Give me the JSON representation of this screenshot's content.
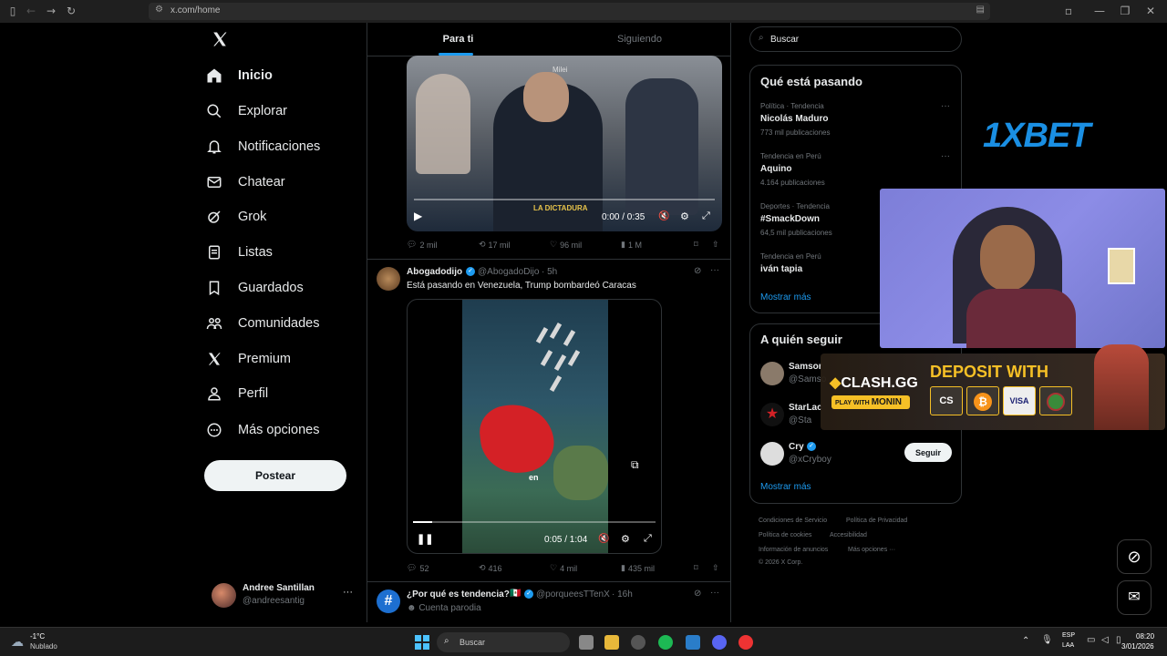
{
  "browser": {
    "url": "x.com/home"
  },
  "nav": {
    "items": [
      {
        "label": "Inicio",
        "icon": "home-icon"
      },
      {
        "label": "Explorar",
        "icon": "search-icon"
      },
      {
        "label": "Notificaciones",
        "icon": "bell-icon"
      },
      {
        "label": "Chatear",
        "icon": "mail-icon"
      },
      {
        "label": "Grok",
        "icon": "grok-icon"
      },
      {
        "label": "Listas",
        "icon": "list-icon"
      },
      {
        "label": "Guardados",
        "icon": "bookmark-icon"
      },
      {
        "label": "Comunidades",
        "icon": "people-icon"
      },
      {
        "label": "Premium",
        "icon": "x-logo-icon"
      },
      {
        "label": "Perfil",
        "icon": "person-icon"
      },
      {
        "label": "Más opciones",
        "icon": "more-circle-icon"
      }
    ],
    "post_label": "Postear"
  },
  "account": {
    "name": "Andree Santillan",
    "handle": "@andreesantig"
  },
  "tabs": {
    "for_you": "Para ti",
    "following": "Siguiendo"
  },
  "tweet1": {
    "video_caption": "LA DICTADURA",
    "video_name_tag": "Milei",
    "time": "0:00 / 0:35",
    "replies": "2 mil",
    "retweets": "17 mil",
    "likes": "96 mil",
    "views": "1 M"
  },
  "tweet2": {
    "name": "Abogadodijo",
    "handle": "@AbogadoDijo",
    "age": "· 5h",
    "text": "Está pasando en Venezuela, Trump bombardeó Caracas",
    "map_label": "en",
    "time": "0:05 / 1:04",
    "progress": 0.08,
    "replies": "52",
    "retweets": "416",
    "likes": "4 mil",
    "views": "435 mil"
  },
  "tweet3": {
    "name": "¿Por qué es tendencia?",
    "flag": "🇲🇽",
    "handle": "@porqueesTTenX",
    "age": "· 16h",
    "badge": "Cuenta parodia"
  },
  "search": {
    "placeholder": "Buscar"
  },
  "trends": {
    "title": "Qué está pasando",
    "items": [
      {
        "meta": "Política · Tendencia",
        "name": "Nicolás Maduro",
        "count": "773 mil publicaciones"
      },
      {
        "meta": "Tendencia en Perú",
        "name": "Aquino",
        "count": "4.164 publicaciones"
      },
      {
        "meta": "Deportes · Tendencia",
        "name": "#SmackDown",
        "count": "64,5 mil publicaciones"
      },
      {
        "meta": "Tendencia en Perú",
        "name": "iván tapia",
        "count": ""
      }
    ],
    "show_more": "Mostrar más"
  },
  "follow": {
    "title": "A quién seguir",
    "items": [
      {
        "name": "Samsor",
        "handle": "@Samso"
      },
      {
        "name": "StarLac",
        "handle": "@Sta"
      },
      {
        "name": "Cry",
        "handle": "@xCryboy"
      }
    ],
    "follow_label": "Seguir",
    "show_more": "Mostrar más"
  },
  "footer": {
    "links": [
      "Condiciones de Servicio",
      "Política de Privacidad",
      "Política de cookies",
      "Accesibilidad",
      "Información de anuncios",
      "Más opciones ···"
    ],
    "copyright": "© 2026 X Corp."
  },
  "overlay": {
    "brand": "1XBET",
    "clash_brand": "CLASH.GG",
    "clash_play": "PLAY WITH",
    "clash_code": "MONIN",
    "deposit": "DEPOSIT WITH",
    "visa": "VISA"
  },
  "taskbar": {
    "temp": "-1°C",
    "weather": "Nublado",
    "search": "Buscar",
    "lang1": "ESP",
    "lang2": "LAA",
    "time": "08:20",
    "date": "3/01/2026"
  },
  "colors": {
    "accent": "#1d9bf0",
    "verified": "#1d9bf0",
    "xbet_blue": "#1a8fe3",
    "clash_yellow": "#f6c026"
  }
}
